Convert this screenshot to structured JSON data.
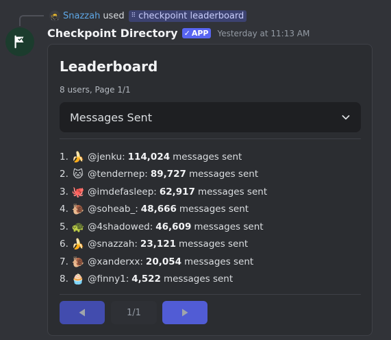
{
  "reply": {
    "user_avatar_icon": "ninja-avatar",
    "user_name": "Snazzah",
    "used_text": "used",
    "command_icon": "slash-command-icon",
    "command_name": "checkpoint leaderboard"
  },
  "header": {
    "avatar_icon": "flag-icon",
    "bot_name": "Checkpoint Directory",
    "badge_label": "APP",
    "timestamp": "Yesterday at 11:13 AM"
  },
  "embed": {
    "title": "Leaderboard",
    "subtitle": "8 users, Page 1/1",
    "select": {
      "value": "Messages Sent",
      "icon": "chevron-down-icon"
    },
    "entries": [
      {
        "rank": "1.",
        "emoji": "🍌",
        "user": "@jenku:",
        "count": "114,024",
        "suffix": "messages sent"
      },
      {
        "rank": "2.",
        "emoji": "🐱",
        "user": "@tendernep:",
        "count": "89,727",
        "suffix": "messages sent"
      },
      {
        "rank": "3.",
        "emoji": "🐙",
        "user": "@imdefasleep:",
        "count": "62,917",
        "suffix": "messages sent"
      },
      {
        "rank": "4.",
        "emoji": "🐌",
        "user": "@soheab_:",
        "count": "48,666",
        "suffix": "messages sent"
      },
      {
        "rank": "5.",
        "emoji": "🐢",
        "user": "@4shadowed:",
        "count": "46,609",
        "suffix": "messages sent"
      },
      {
        "rank": "6.",
        "emoji": "🍌",
        "user": "@snazzah:",
        "count": "23,121",
        "suffix": "messages sent"
      },
      {
        "rank": "7.",
        "emoji": "🐌",
        "user": "@xanderxx:",
        "count": "20,054",
        "suffix": "messages sent"
      },
      {
        "rank": "8.",
        "emoji": "🧁",
        "user": "@finny1:",
        "count": "4,522",
        "suffix": "messages sent"
      }
    ],
    "pagination": {
      "prev_icon": "arrow-left-icon",
      "page_label": "1/1",
      "next_icon": "arrow-right-icon"
    }
  },
  "colors": {
    "background": "#313338",
    "embed_background": "#2b2d31",
    "accent": "#5865f2",
    "link": "#5ea7e6"
  }
}
